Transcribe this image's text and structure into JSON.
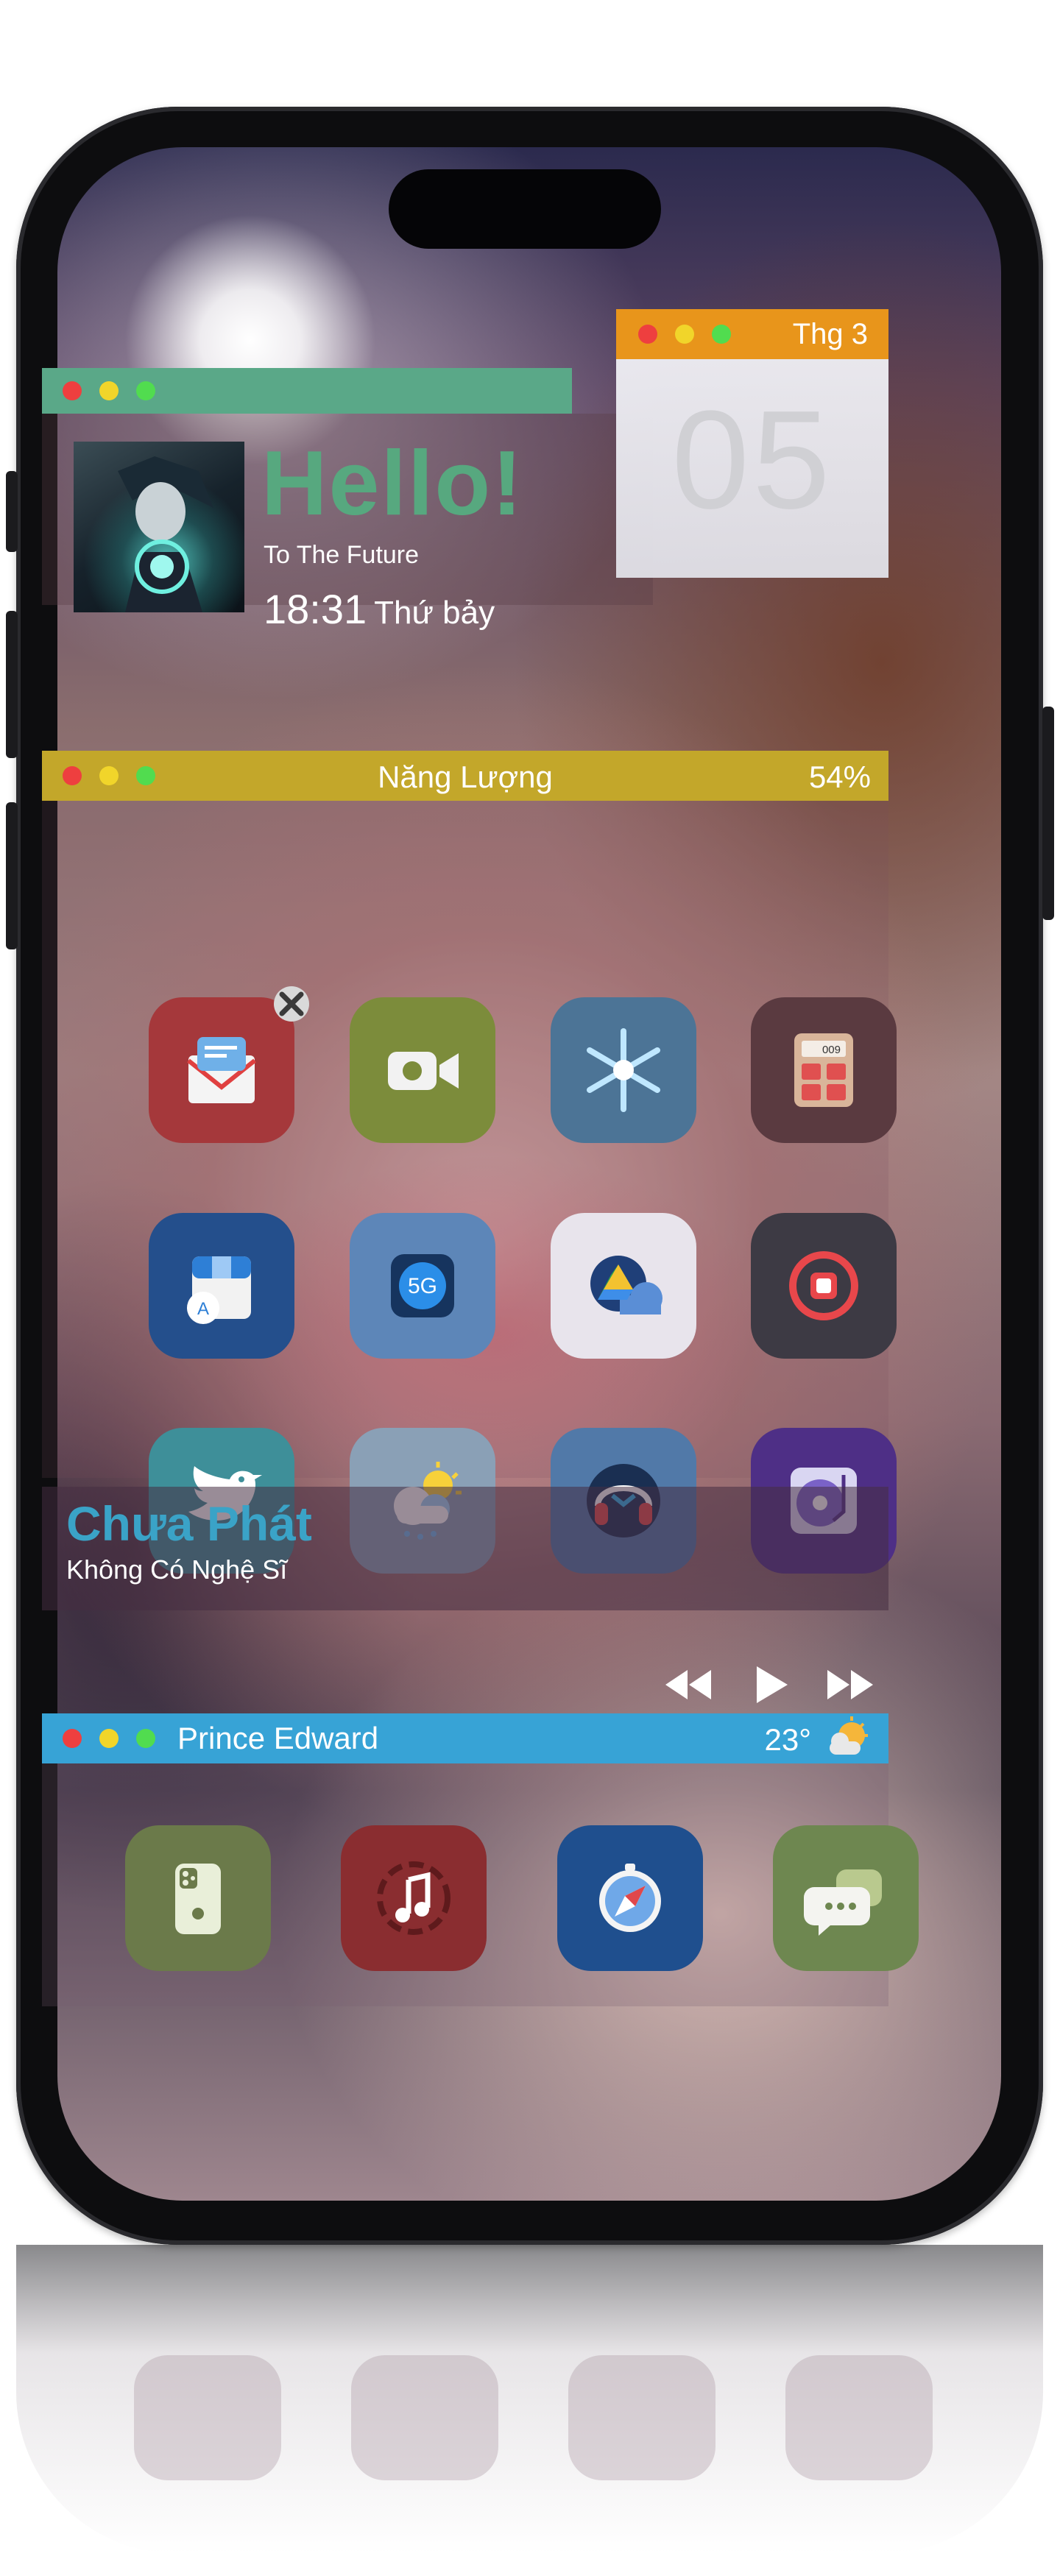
{
  "hello_widget": {
    "title": "Hello!",
    "subtitle": "To The Future",
    "time": "18:31",
    "day": "Thứ bảy"
  },
  "calendar_widget": {
    "month": "Thg 3",
    "day": "05"
  },
  "energy_widget": {
    "title": "Năng Lượng",
    "battery_percent": "54%"
  },
  "apps": [
    {
      "name": "mail",
      "bg": "#a5383b"
    },
    {
      "name": "facetime",
      "bg": "#7c8c3b"
    },
    {
      "name": "snowflake",
      "bg": "#4c7496"
    },
    {
      "name": "calculator",
      "bg": "#5a3a40",
      "display": "009"
    },
    {
      "name": "app-store",
      "bg": "#244f8c"
    },
    {
      "name": "5g",
      "bg": "#5d86b8",
      "label": "5G"
    },
    {
      "name": "google-drive",
      "bg": "#e8e4ec"
    },
    {
      "name": "screen-record",
      "bg": "#3d3a44"
    },
    {
      "name": "twitter",
      "bg": "#3e8f99"
    },
    {
      "name": "weather",
      "bg": "#8aa0b6"
    },
    {
      "name": "headphones",
      "bg": "#5179a8"
    },
    {
      "name": "music-turntable",
      "bg": "#4e2f86"
    }
  ],
  "music_widget": {
    "title": "Chưa Phát",
    "artist": "Không Có Nghệ Sĩ",
    "controls": [
      "rewind-icon",
      "play-icon",
      "fast-forward-icon"
    ]
  },
  "weather_widget": {
    "city": "Prince Edward",
    "temperature": "23°",
    "condition_icon": "partly-cloudy-icon"
  },
  "dock": [
    {
      "name": "phone-finder",
      "bg": "#6b7a4a"
    },
    {
      "name": "music",
      "bg": "#8a2d30"
    },
    {
      "name": "safari",
      "bg": "#1f4f8e"
    },
    {
      "name": "messages",
      "bg": "#6e8750"
    }
  ]
}
